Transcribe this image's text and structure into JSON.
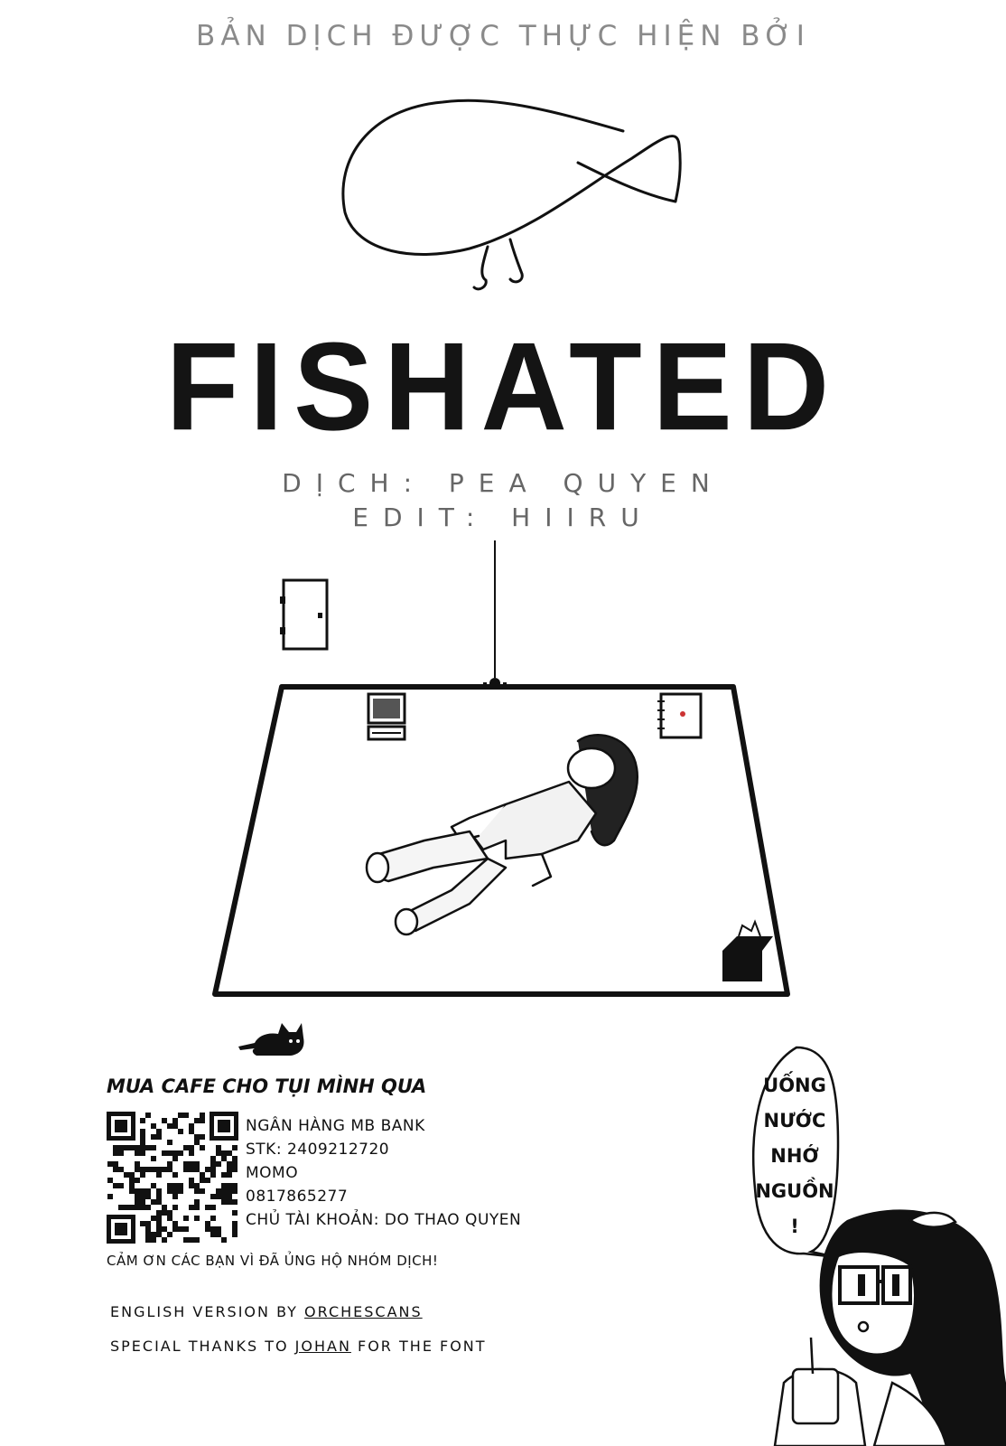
{
  "header": {
    "translation_credit": "BẢN DỊCH ĐƯỢC THỰC HIỆN BỞI"
  },
  "title": "FISHATED",
  "credits": {
    "translator": "DỊCH: PEA QUYEN",
    "editor": "EDIT: HIIRU"
  },
  "donate": {
    "title": "MUA CAFE CHO TỤI MÌNH QUA",
    "lines": [
      "NGÂN HÀNG MB BANK",
      "STK: 2409212720",
      "MOMO",
      "0817865277",
      "CHỦ TÀI KHOẢN: DO THAO QUYEN"
    ],
    "thanks": "CẢM ƠN CÁC BẠN VÌ ĐÃ ỦNG HỘ NHÓM DỊCH!"
  },
  "english_credit": {
    "prefix": "ENGLISH VERSION BY ",
    "name": "ORCHESCANS"
  },
  "font_credit": {
    "prefix": "SPECIAL THANKS TO ",
    "name": "JOHAN",
    "suffix": " FOR THE FONT"
  },
  "speech_bubble": {
    "lines": [
      "UỐNG",
      "NƯỚC",
      "NHỚ",
      "NGUỒN",
      "!"
    ]
  },
  "colors": {
    "header_text": "#8a8a8a",
    "title_text": "#141414",
    "credit_text": "#666666"
  }
}
